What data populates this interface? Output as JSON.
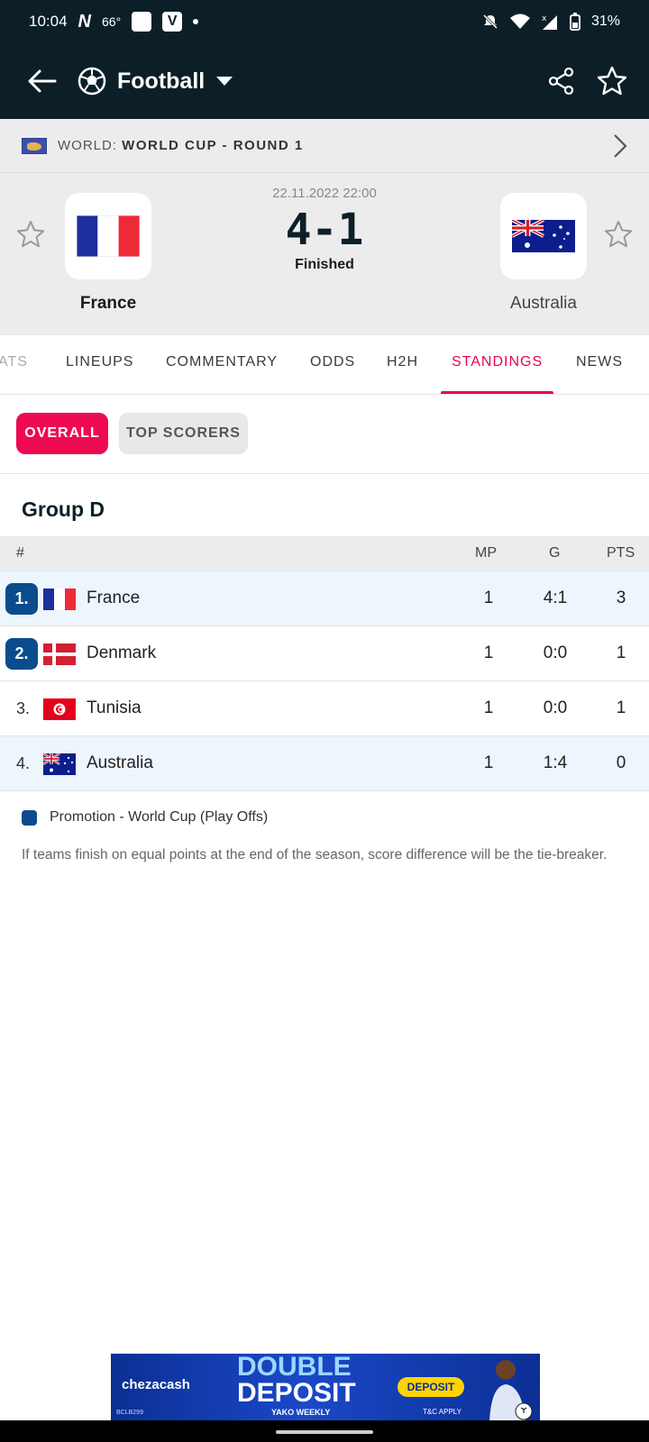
{
  "status_bar": {
    "time": "10:04",
    "app_letter": "N",
    "temperature": "66°",
    "v_icon": "V",
    "battery": "31%"
  },
  "app_bar": {
    "sport": "Football"
  },
  "competition": {
    "prefix": "WORLD:",
    "name": "WORLD CUP - ROUND 1"
  },
  "match": {
    "datetime": "22.11.2022 22:00",
    "score": "4-1",
    "status": "Finished",
    "home": {
      "name": "France"
    },
    "away": {
      "name": "Australia"
    }
  },
  "tabs": [
    {
      "label": "ATS"
    },
    {
      "label": "LINEUPS"
    },
    {
      "label": "COMMENTARY"
    },
    {
      "label": "ODDS"
    },
    {
      "label": "H2H"
    },
    {
      "label": "STANDINGS"
    },
    {
      "label": "NEWS"
    }
  ],
  "filters": {
    "overall": "OVERALL",
    "top_scorers": "TOP SCORERS"
  },
  "group": {
    "title": "Group D",
    "headers": {
      "rank": "#",
      "mp": "MP",
      "g": "G",
      "pts": "PTS"
    },
    "rows": [
      {
        "rank": "1.",
        "team": "France",
        "mp": "1",
        "g": "4:1",
        "pts": "3"
      },
      {
        "rank": "2.",
        "team": "Denmark",
        "mp": "1",
        "g": "0:0",
        "pts": "1"
      },
      {
        "rank": "3.",
        "team": "Tunisia",
        "mp": "1",
        "g": "0:0",
        "pts": "1"
      },
      {
        "rank": "4.",
        "team": "Australia",
        "mp": "1",
        "g": "1:4",
        "pts": "0"
      }
    ]
  },
  "legend": {
    "promotion": "Promotion - World Cup (Play Offs)",
    "note": "If teams finish on equal points at the end of the season, score difference will be the tie-breaker."
  },
  "ad": {
    "brand": "chezacash",
    "headline1": "DOUBLE",
    "headline2": "DEPOSIT",
    "sub": "YAKO WEEKLY",
    "button": "DEPOSIT",
    "tc": "T&C APPLY",
    "small": "BCLB299"
  },
  "colors": {
    "dark_header": "#0c1f27",
    "accent": "#e8064e",
    "promotion": "#0a4c8c",
    "highlight_row": "#edf5fd"
  }
}
